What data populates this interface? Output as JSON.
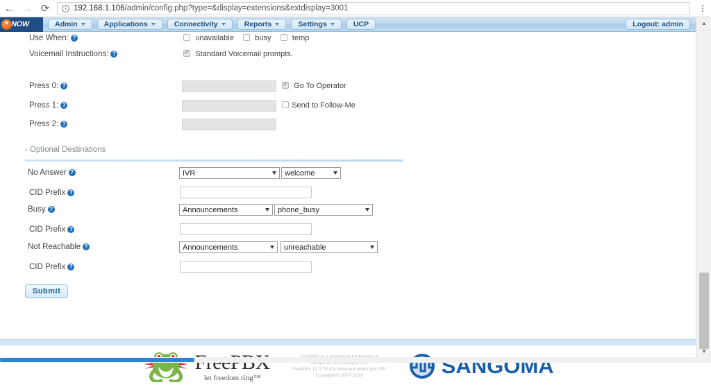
{
  "browser": {
    "back_icon": "back-arrow-icon",
    "forward_icon": "forward-arrow-icon",
    "reload_icon": "reload-icon",
    "info_icon": "info-icon",
    "info_glyph": "i",
    "url_host": "192.168.1.106",
    "url_path": "/admin/config.php?type=&display=extensions&extdisplay=3001",
    "menu_icon": "overflow-menu-icon"
  },
  "topnav": {
    "brand_star": "*",
    "brand_text": "NOW",
    "items": [
      {
        "label": "Admin",
        "has_caret": true
      },
      {
        "label": "Applications",
        "has_caret": true
      },
      {
        "label": "Connectivity",
        "has_caret": true
      },
      {
        "label": "Reports",
        "has_caret": true
      },
      {
        "label": "Settings",
        "has_caret": true
      },
      {
        "label": "UCP",
        "has_caret": false
      }
    ],
    "logout_label": "Logout: admin"
  },
  "form": {
    "use_when": {
      "label": "Use When:",
      "options": [
        {
          "label": "unavailable",
          "checked": false
        },
        {
          "label": "busy",
          "checked": false
        },
        {
          "label": "temp",
          "checked": false
        }
      ]
    },
    "voicemail_instructions": {
      "label": "Voicemail Instructions:",
      "option_label": "Standard Voicemail prompts.",
      "checked": true
    },
    "press0": {
      "label": "Press 0:",
      "value": "",
      "disabled": true,
      "checkbox_label": "Go To Operator",
      "checked": true
    },
    "press1": {
      "label": "Press 1:",
      "value": "",
      "disabled": true,
      "checkbox_label": "Send to Follow-Me",
      "checked": false
    },
    "press2": {
      "label": "Press 2:",
      "value": "",
      "disabled": true
    },
    "optional_destinations": {
      "section_title": "- Optional Destinations",
      "no_answer": {
        "label": "No Answer",
        "dest_type": "IVR",
        "dest_value": "welcome"
      },
      "no_answer_cid": {
        "label": "CID Prefix",
        "value": ""
      },
      "busy": {
        "label": "Busy",
        "dest_type": "Announcements",
        "dest_value": "phone_busy"
      },
      "busy_cid": {
        "label": "CID Prefix",
        "value": ""
      },
      "not_reachable": {
        "label": "Not Reachable",
        "dest_type": "Announcements",
        "dest_value": "unreachable"
      },
      "not_reachable_cid": {
        "label": "CID Prefix",
        "value": ""
      }
    },
    "submit_label": "Submit"
  },
  "footer": {
    "freepbx_name": "FreePBX",
    "freepbx_tagline": "let freedom ring™",
    "license_text": "FreePBX is a registered trademark of\nSangoma Technologies Inc.\nFreePBX 12.0.76.4 is licensed under the GPL\nCopyright® 2007-2016",
    "sangoma_name": "SANGOMA"
  },
  "scrollbars": {
    "vertical_up_glyph": "▲",
    "vertical_down_glyph": "▼"
  },
  "colors": {
    "accent_blue": "#1f6fb8",
    "nav_blue": "#1f4e86",
    "brand_orange": "#e8661b",
    "sangoma_blue": "#1860ab"
  }
}
